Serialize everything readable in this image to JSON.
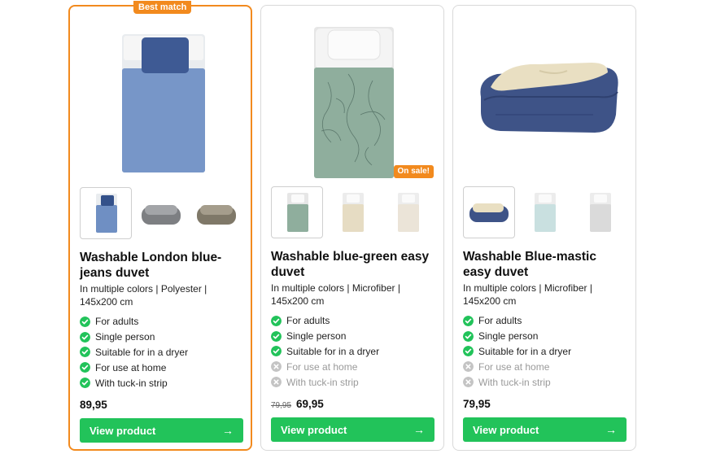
{
  "theme": {
    "accent": "#f28a1e",
    "cta": "#22c35a",
    "check": "#22c35a",
    "cross": "#c4c4c4"
  },
  "products": [
    {
      "badge": "Best match",
      "sale_badge": "",
      "title": "Washable London blue-jeans duvet",
      "subtitle": "In multiple colors | Polyester | 145x200 cm",
      "features": [
        {
          "label": "For adults",
          "available": true
        },
        {
          "label": "Single person",
          "available": true
        },
        {
          "label": "Suitable for in a dryer",
          "available": true
        },
        {
          "label": "For use at home",
          "available": true
        },
        {
          "label": "With tuck-in strip",
          "available": true
        }
      ],
      "old_price": "",
      "price": "89,95",
      "cta_label": "View product",
      "cta_arrow": "→",
      "image": "duvet-bed-blue-jeans",
      "thumbnails": [
        {
          "image": "duvet-bed-blue-jeans",
          "selected": true
        },
        {
          "image": "folded-duvet-grey",
          "selected": false
        },
        {
          "image": "folded-duvet-taupe",
          "selected": false
        }
      ]
    },
    {
      "badge": "",
      "sale_badge": "On sale!",
      "title": "Washable blue-green easy duvet",
      "subtitle": "In multiple colors | Microfiber | 145x200 cm",
      "features": [
        {
          "label": "For adults",
          "available": true
        },
        {
          "label": "Single person",
          "available": true
        },
        {
          "label": "Suitable for in a dryer",
          "available": true
        },
        {
          "label": "For use at home",
          "available": false
        },
        {
          "label": "With tuck-in strip",
          "available": false
        }
      ],
      "old_price": "79,95",
      "price": "69,95",
      "cta_label": "View product",
      "cta_arrow": "→",
      "image": "duvet-bed-blue-green-floral",
      "thumbnails": [
        {
          "image": "duvet-bed-blue-green-floral",
          "selected": true
        },
        {
          "image": "duvet-bed-beige-floral",
          "selected": false
        },
        {
          "image": "duvet-bed-cream-floral",
          "selected": false
        }
      ]
    },
    {
      "badge": "",
      "sale_badge": "",
      "title": "Washable Blue-mastic easy duvet",
      "subtitle": "In multiple colors | Microfiber | 145x200 cm",
      "features": [
        {
          "label": "For adults",
          "available": true
        },
        {
          "label": "Single person",
          "available": true
        },
        {
          "label": "Suitable for in a dryer",
          "available": true
        },
        {
          "label": "For use at home",
          "available": false
        },
        {
          "label": "With tuck-in strip",
          "available": false
        }
      ],
      "old_price": "",
      "price": "79,95",
      "cta_label": "View product",
      "cta_arrow": "→",
      "image": "folded-duvet-blue-mastic",
      "thumbnails": [
        {
          "image": "folded-duvet-blue-mastic",
          "selected": true
        },
        {
          "image": "duvet-bed-light-blue",
          "selected": false
        },
        {
          "image": "duvet-bed-light-grey",
          "selected": false
        }
      ]
    }
  ]
}
